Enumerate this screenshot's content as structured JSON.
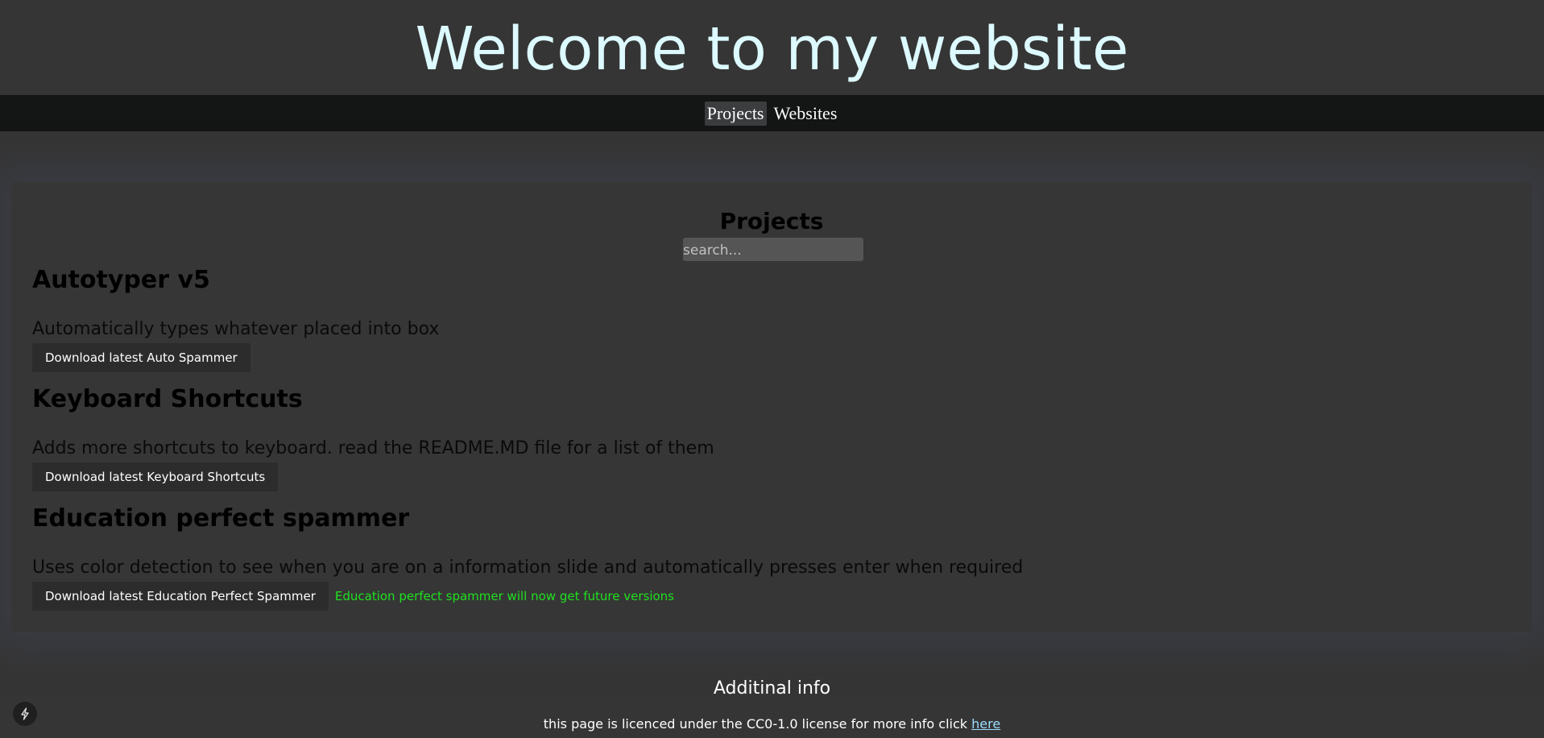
{
  "header": {
    "title": "Welcome to my website"
  },
  "nav": {
    "items": [
      {
        "label": "Projects"
      },
      {
        "label": "Websites"
      }
    ]
  },
  "projects": {
    "heading": "Projects",
    "search_placeholder": "search...",
    "items": [
      {
        "title": "Autotyper v5",
        "description": "Automatically types whatever placed into box",
        "button": "Download latest Auto Spammer"
      },
      {
        "title": "Keyboard Shortcuts",
        "description": "Adds more shortcuts to keyboard. read the README.MD file for a list of them",
        "button": "Download latest Keyboard Shortcuts"
      },
      {
        "title": "Education perfect spammer",
        "description": "Uses color detection to see when you are on a information slide and automatically presses enter when required",
        "button": "Download latest Education Perfect Spammer",
        "note": "Education perfect spammer will now get future versions"
      }
    ]
  },
  "footer": {
    "heading": "Additinal info",
    "text": "this page is licenced under the CC0-1.0 license for more info click ",
    "link": "here"
  },
  "colors": {
    "background": "#353535",
    "title": "#dcfaff",
    "nav_bar": "#141515",
    "note_green": "#1fe11f",
    "link": "#9bdcff"
  },
  "icons": {
    "corner": "bolt-icon"
  }
}
